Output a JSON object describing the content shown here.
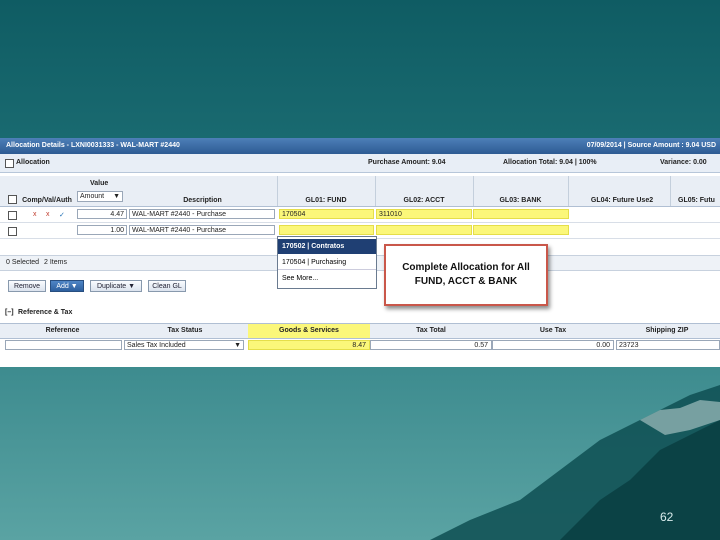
{
  "window": {
    "title": "Allocation Details - LXNI0031333 - WAL-MART #2440",
    "info": "07/09/2014 | Source Amount : 9.04 USD"
  },
  "allocation": {
    "label": "Allocation",
    "purchase_amount": "Purchase Amount: 9.04",
    "allocation_total": "Allocation Total: 9.04 | 100%",
    "variance": "Variance: 0.00"
  },
  "columns": {
    "comp": "Comp/Val/Auth",
    "value": "Value",
    "description": "Description",
    "gl01": "GL01: FUND",
    "gl02": "GL02: ACCT",
    "gl03": "GL03: BANK",
    "gl04": "GL04: Future Use2",
    "gl05": "GL05: Futu"
  },
  "value_select": "Amount",
  "rows": [
    {
      "flags": [
        "x",
        "x",
        "✓"
      ],
      "amount": "4.47",
      "description": "WAL-MART #2440 - Purchase",
      "gl01": "170504",
      "gl02": "311010",
      "gl03": ""
    },
    {
      "flags": [],
      "amount": "1.00",
      "description": "WAL-MART #2440 - Purchase",
      "gl01": "",
      "gl02": "",
      "gl03": ""
    }
  ],
  "dropdown": {
    "items": [
      "170502 | Contratos",
      "170504 | Purchasing",
      "See More..."
    ]
  },
  "selection": {
    "selected": "0 Selected",
    "items": "2 Items"
  },
  "buttons": {
    "remove": "Remove",
    "add": "Add ▼",
    "duplicate": "Duplicate ▼",
    "clean": "Clean GL"
  },
  "reference_section": {
    "title": "Reference & Tax",
    "headers": [
      "Reference",
      "Tax Status",
      "Goods & Services",
      "Tax Total",
      "Use Tax",
      "Shipping ZIP"
    ],
    "tax_status": "Sales Tax Included",
    "goods_services": "8.47",
    "tax_total": "0.57",
    "use_tax": "0.00",
    "zip": "23723"
  },
  "callout": {
    "line1": "Complete Allocation for All",
    "line2": "FUND, ACCT & BANK"
  },
  "slide_number": "62",
  "colors": {
    "background": "#1d6f75",
    "highlight": "#fbf77a",
    "callout_border": "#c9574a",
    "titlebar": "#2d5b93"
  }
}
